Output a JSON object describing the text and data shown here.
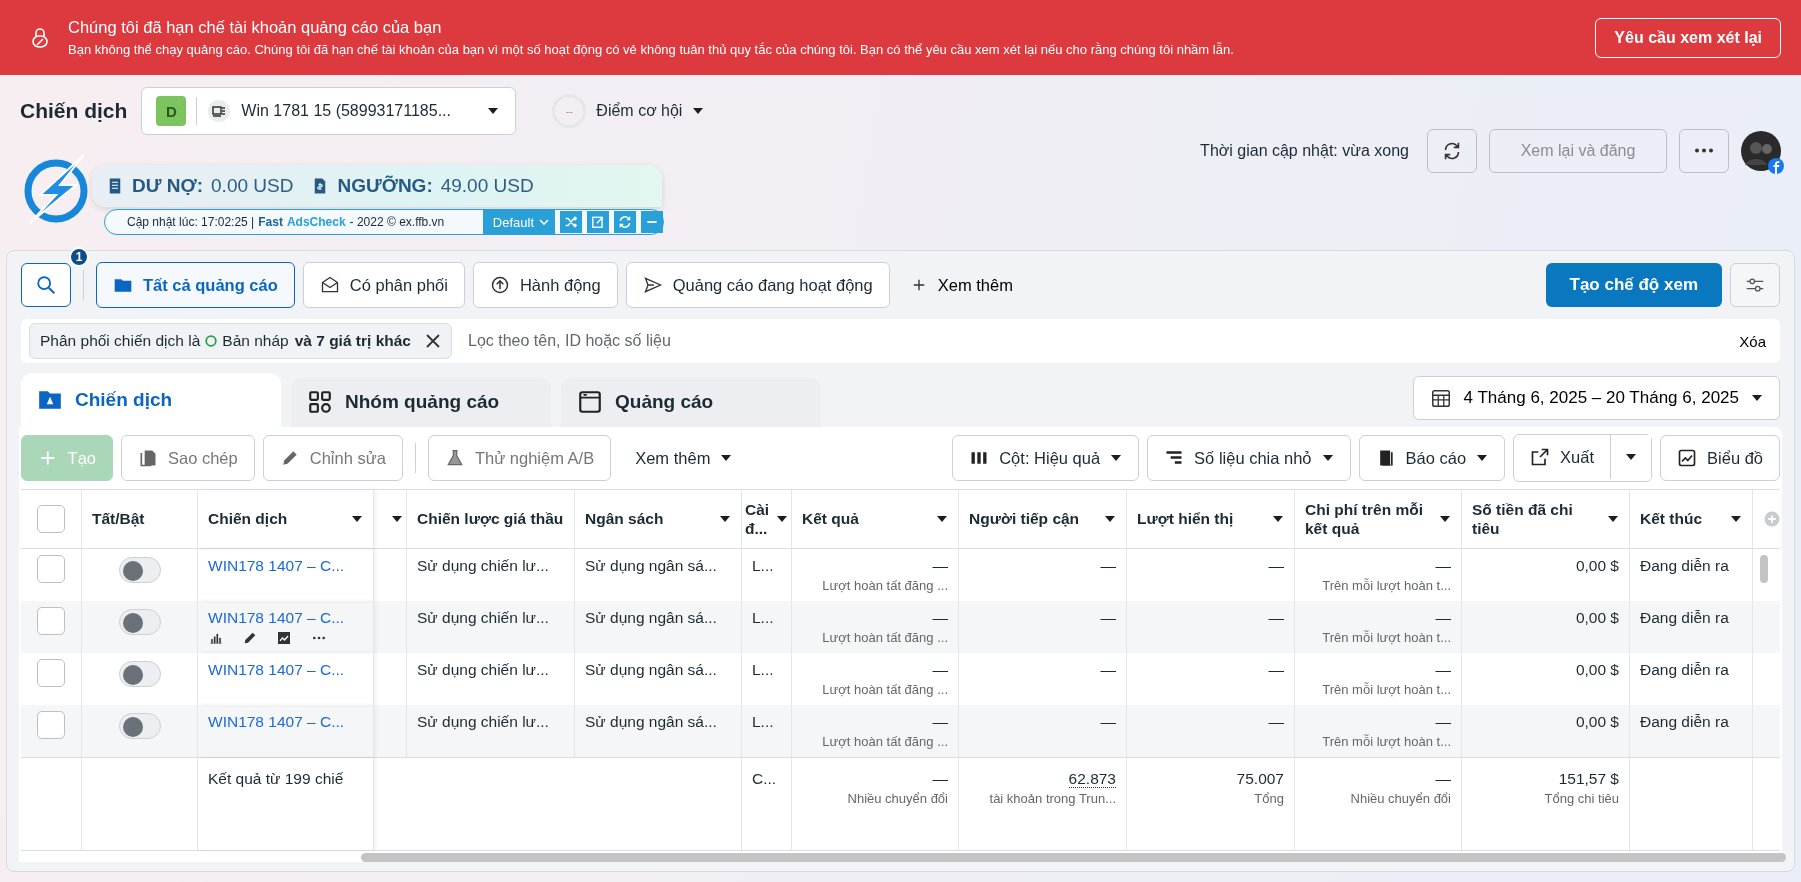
{
  "banner": {
    "title": "Chúng tôi đã hạn chế tài khoản quảng cáo của bạn",
    "message": "Bạn không thể chạy quảng cáo. Chúng tôi đã hạn chế tài khoản của bạn vì một số hoạt động có vẻ không tuân thủ quy tắc của chúng tôi. Bạn có thể yêu cầu xem xét lại nếu cho rằng chúng tôi nhầm lẫn.",
    "button": "Yêu cầu xem xét lại"
  },
  "header": {
    "title": "Chiến dịch",
    "account": {
      "badge": "D",
      "name": "Win 1781 15 (58993171185..."
    },
    "opportunity": {
      "score": "--",
      "label": "Điểm cơ hội"
    },
    "update_time": "Thời gian cập nhật: vừa xong",
    "review_button": {
      "label": "Xem lại và đăng",
      "disabled": true
    }
  },
  "extension": {
    "debt_label": "DƯ NỢ:",
    "debt_value": "0.00 USD",
    "threshold_label": "NGƯỠNG:",
    "threshold_value": "49.00 USD",
    "updated": "Cập nhật lúc: 17:02:25 |",
    "brand_first": "Fast",
    "brand_second": "AdsCheck",
    "copyright": "- 2022 © ex.ffb.vn",
    "profile": "Default"
  },
  "search_badge": "1",
  "view_tabs": [
    {
      "label": "Tất cả quảng cáo",
      "selected": true
    },
    {
      "label": "Có phân phối",
      "selected": false
    },
    {
      "label": "Hành động",
      "selected": false
    },
    {
      "label": "Quảng cáo đang hoạt động",
      "selected": false
    }
  ],
  "more_views": "Xem thêm",
  "create_view": "Tạo chế độ xem",
  "filter": {
    "prefix": "Phân phối chiến dịch là",
    "value": "Bản nháp",
    "suffix": "và 7 giá trị khác",
    "placeholder": "Lọc theo tên, ID hoặc số liệu",
    "clear": "Xóa"
  },
  "level_tabs": [
    {
      "label": "Chiến dịch",
      "selected": true
    },
    {
      "label": "Nhóm quảng cáo",
      "selected": false
    },
    {
      "label": "Quảng cáo",
      "selected": false
    }
  ],
  "date_range": "4 Tháng 6, 2025 – 20 Tháng 6, 2025",
  "toolbar_left": [
    {
      "label": "Tạo",
      "kind": "create",
      "disabled": true
    },
    {
      "label": "Sao chép",
      "kind": "outline",
      "disabled": true
    },
    {
      "label": "Chỉnh sửa",
      "kind": "outline",
      "disabled": true
    },
    {
      "label": "Thử nghiệm A/B",
      "kind": "outline",
      "disabled": true
    },
    {
      "label": "Xem thêm",
      "kind": "menu",
      "disabled": false
    }
  ],
  "toolbar_right": [
    {
      "label": "Cột: Hiệu quả",
      "kind": "dropdown"
    },
    {
      "label": "Số liệu chia nhỏ",
      "kind": "dropdown"
    },
    {
      "label": "Báo cáo",
      "kind": "dropdown"
    },
    {
      "label": "Xuất",
      "kind": "split"
    },
    {
      "label": "Biểu đồ",
      "kind": "plain"
    }
  ],
  "table": {
    "columns": [
      {
        "kind": "check",
        "checked": false
      },
      {
        "label": "Tất/Bật",
        "kind": "toggle",
        "has_menu": false
      },
      {
        "label": "Chiến dịch",
        "kind": "name",
        "has_menu": true
      },
      {
        "kind": "blank",
        "has_menu": true
      },
      {
        "label": "Chiến lược giá thầu",
        "kind": "text",
        "has_menu": false
      },
      {
        "label": "Ngân sách",
        "kind": "text",
        "has_menu": true
      },
      {
        "label": "Cài đ...",
        "kind": "text",
        "has_menu": true
      },
      {
        "label": "Kết quả",
        "kind": "metric",
        "has_menu": true
      },
      {
        "label": "Người tiếp cận",
        "kind": "metric",
        "has_menu": true
      },
      {
        "label": "Lượt hiển thị",
        "kind": "metric",
        "has_menu": true
      },
      {
        "label": "Chi phí trên mỗi kết quả",
        "kind": "metric",
        "has_menu": true
      },
      {
        "label": "Số tiền đã chi tiêu",
        "kind": "metric",
        "has_menu": true
      },
      {
        "label": "Kết thúc",
        "kind": "text",
        "has_menu": true
      },
      {
        "kind": "add"
      }
    ],
    "rows": [
      {
        "checked": false,
        "on": false,
        "show_actions": false,
        "name": "WIN178 1407 – C...",
        "bid_strategy": "Sử dụng chiến lư...",
        "budget": "Sử dụng ngân sá...",
        "setting": "L...",
        "results": "—",
        "results_note": "Lượt hoàn tất đăng ...",
        "reach": "—",
        "impressions": "—",
        "cost": "—",
        "cost_note": "Trên mỗi lượt hoàn t...",
        "spent": "0,00 $",
        "end": "Đang diễn ra"
      },
      {
        "checked": false,
        "on": false,
        "show_actions": true,
        "name": "WIN178 1407 – C...",
        "bid_strategy": "Sử dụng chiến lư...",
        "budget": "Sử dụng ngân sá...",
        "setting": "L...",
        "results": "—",
        "results_note": "Lượt hoàn tất đăng ...",
        "reach": "—",
        "impressions": "—",
        "cost": "—",
        "cost_note": "Trên mỗi lượt hoàn t...",
        "spent": "0,00 $",
        "end": "Đang diễn ra"
      },
      {
        "checked": false,
        "on": false,
        "show_actions": false,
        "name": "WIN178 1407 – C...",
        "bid_strategy": "Sử dụng chiến lư...",
        "budget": "Sử dụng ngân sá...",
        "setting": "L...",
        "results": "—",
        "results_note": "Lượt hoàn tất đăng ...",
        "reach": "—",
        "impressions": "—",
        "cost": "—",
        "cost_note": "Trên mỗi lượt hoàn t...",
        "spent": "0,00 $",
        "end": "Đang diễn ra"
      },
      {
        "checked": false,
        "on": false,
        "show_actions": false,
        "name": "WIN178 1407 – C...",
        "bid_strategy": "Sử dụng chiến lư...",
        "budget": "Sử dụng ngân sá...",
        "setting": "L...",
        "results": "—",
        "results_note": "Lượt hoàn tất đăng ...",
        "reach": "—",
        "impressions": "—",
        "cost": "—",
        "cost_note": "Trên mỗi lượt hoàn t...",
        "spent": "0,00 $",
        "end": "Đang diễn ra"
      }
    ],
    "footer": {
      "summary": "Kết quả từ 199 chiế",
      "setting": "C...",
      "results": "—",
      "results_note": "Nhiều chuyển đổi",
      "reach": "62.873",
      "reach_note": "tài khoản trong Trun...",
      "impressions": "75.007",
      "impressions_note": "Tổng",
      "cost": "—",
      "cost_note": "Nhiều chuyển đổi",
      "spent": "151,57 $",
      "spent_note": "Tổng chi tiêu"
    }
  }
}
